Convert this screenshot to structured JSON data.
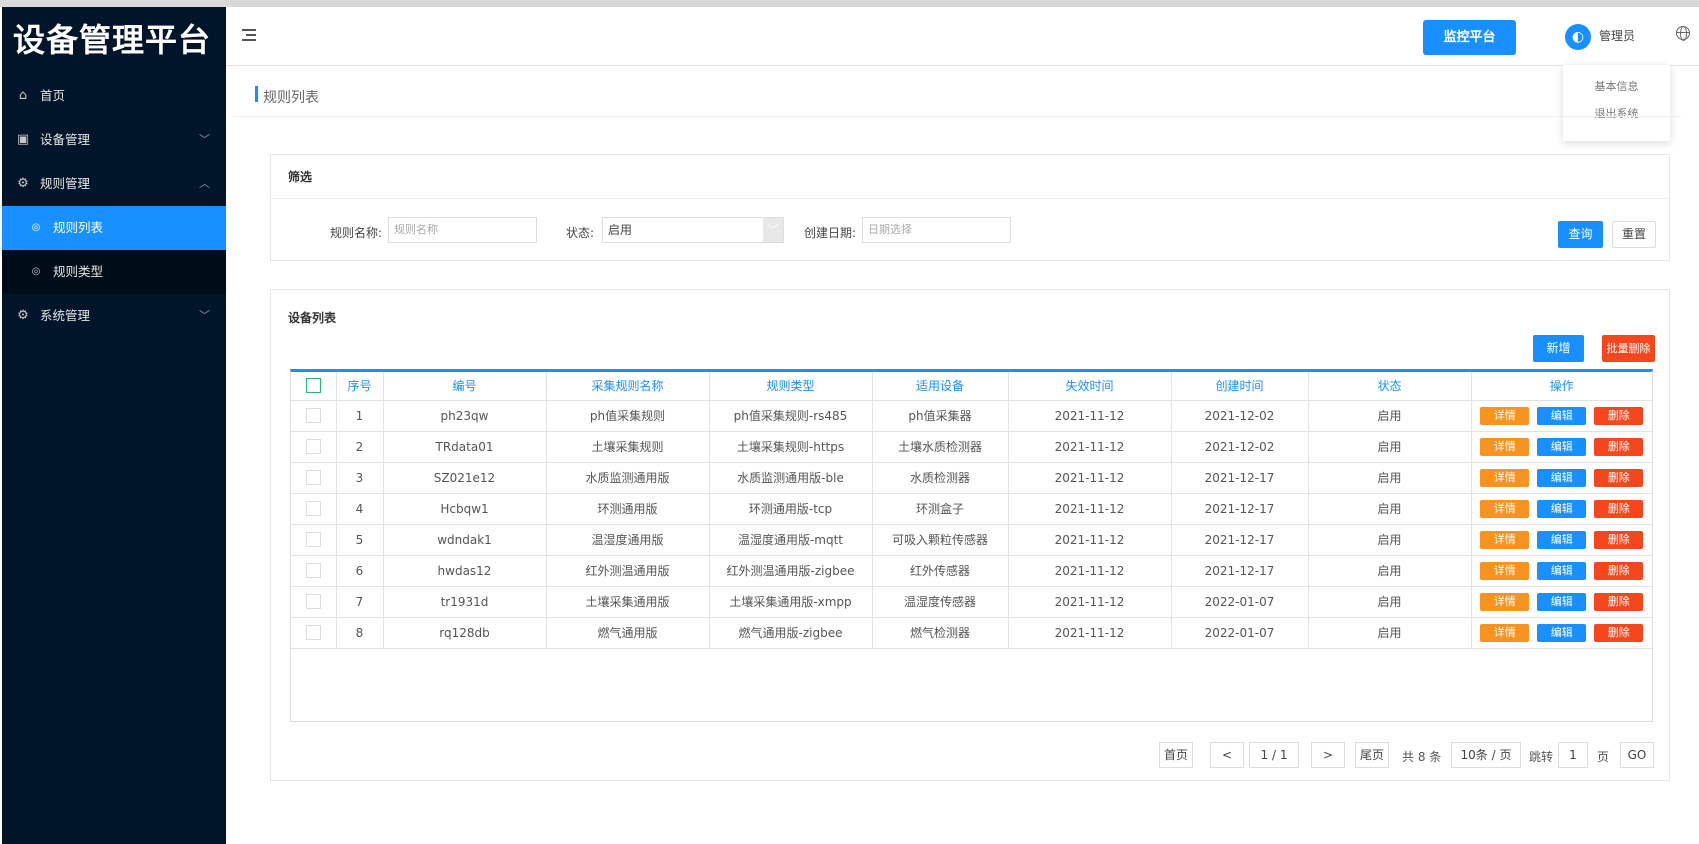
{
  "app": {
    "title": "设备管理平台"
  },
  "sidebar": {
    "items": [
      {
        "label": "首页",
        "icon": "home-icon"
      },
      {
        "label": "设备管理",
        "icon": "device-icon"
      },
      {
        "label": "规则管理",
        "icon": "rule-icon"
      },
      {
        "label": "系统管理",
        "icon": "gear-icon"
      }
    ],
    "sub_items": [
      {
        "label": "规则列表",
        "active": true
      },
      {
        "label": "规则类型",
        "active": false
      }
    ]
  },
  "header": {
    "monitor_button": "监控平台",
    "user_name": "管理员",
    "dropdown": [
      "基本信息",
      "退出系统"
    ]
  },
  "page": {
    "title": "规则列表"
  },
  "filter": {
    "title": "筛选",
    "name_label": "规则名称:",
    "name_placeholder": "规则名称",
    "status_label": "状态:",
    "status_value": "启用",
    "date_label": "创建日期:",
    "date_placeholder": "日期选择",
    "query_button": "查询",
    "reset_button": "重置"
  },
  "list": {
    "title": "设备列表",
    "add_button": "新增",
    "batch_delete_button": "批量删除",
    "columns": [
      "序号",
      "编号",
      "采集规则名称",
      "规则类型",
      "适用设备",
      "失效时间",
      "创建时间",
      "状态",
      "操作"
    ],
    "action_labels": {
      "detail": "详情",
      "edit": "编辑",
      "delete": "删除"
    },
    "rows": [
      {
        "index": "1",
        "code": "ph23qw",
        "name": "ph值采集规则",
        "type": "ph值采集规则-rs485",
        "device": "ph值采集器",
        "expire": "2021-11-12",
        "created": "2021-12-02",
        "status": "启用"
      },
      {
        "index": "2",
        "code": "TRdata01",
        "name": "土壤采集规则",
        "type": "土壤采集规则-https",
        "device": "土壤水质检测器",
        "expire": "2021-11-12",
        "created": "2021-12-02",
        "status": "启用"
      },
      {
        "index": "3",
        "code": "SZ021e12",
        "name": "水质监测通用版",
        "type": "水质监测通用版-ble",
        "device": "水质检测器",
        "expire": "2021-11-12",
        "created": "2021-12-17",
        "status": "启用"
      },
      {
        "index": "4",
        "code": "Hcbqw1",
        "name": "环测通用版",
        "type": "环测通用版-tcp",
        "device": "环测盒子",
        "expire": "2021-11-12",
        "created": "2021-12-17",
        "status": "启用"
      },
      {
        "index": "5",
        "code": "wdndak1",
        "name": "温湿度通用版",
        "type": "温湿度通用版-mqtt",
        "device": "可吸入颗粒传感器",
        "expire": "2021-11-12",
        "created": "2021-12-17",
        "status": "启用"
      },
      {
        "index": "6",
        "code": "hwdas12",
        "name": "红外测温通用版",
        "type": "红外测温通用版-zigbee",
        "device": "红外传感器",
        "expire": "2021-11-12",
        "created": "2021-12-17",
        "status": "启用"
      },
      {
        "index": "7",
        "code": "tr1931d",
        "name": "土壤采集通用版",
        "type": "土壤采集通用版-xmpp",
        "device": "温湿度传感器",
        "expire": "2021-11-12",
        "created": "2022-01-07",
        "status": "启用"
      },
      {
        "index": "8",
        "code": "rq128db",
        "name": "燃气通用版",
        "type": "燃气通用版-zigbee",
        "device": "燃气检测器",
        "expire": "2021-11-12",
        "created": "2022-01-07",
        "status": "启用"
      }
    ]
  },
  "pagination": {
    "first": "首页",
    "prev": "<",
    "page_indicator": "1 / 1",
    "next": ">",
    "last": "尾页",
    "total": "共 8 条",
    "page_size": "10条 / 页",
    "jump_label": "跳转",
    "jump_value": "1",
    "page_unit": "页",
    "go": "GO"
  },
  "colors": {
    "sidebar_bg": "#001529",
    "accent": "#1890ff",
    "detail": "#f7931e",
    "delete": "#f5461d"
  }
}
